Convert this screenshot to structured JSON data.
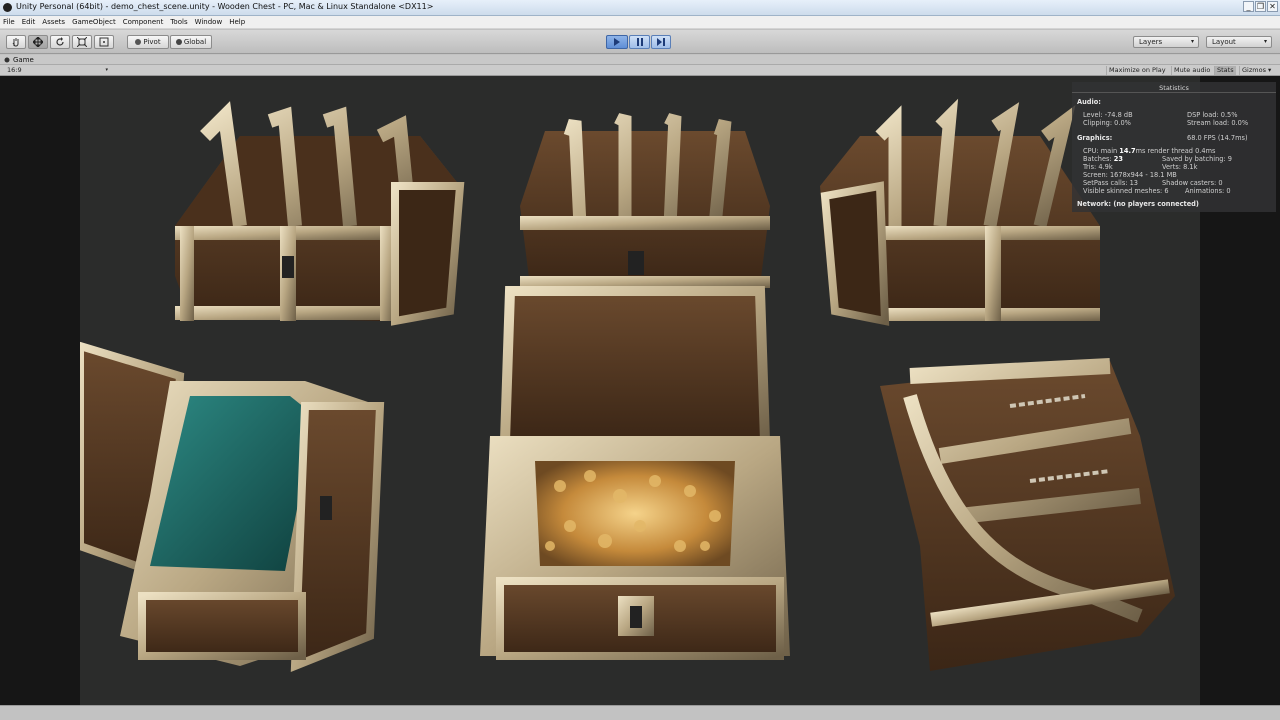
{
  "window": {
    "title": "Unity Personal (64bit) - demo_chest_scene.unity - Wooden Chest - PC, Mac & Linux Standalone <DX11>",
    "minimize": "_",
    "restore": "❐",
    "close": "✕"
  },
  "menu": [
    "File",
    "Edit",
    "Assets",
    "GameObject",
    "Component",
    "Tools",
    "Window",
    "Help"
  ],
  "toolbar": {
    "pivot_label": "Pivot",
    "global_label": "Global",
    "layers_label": "Layers",
    "layout_label": "Layout"
  },
  "game_view": {
    "tab_label": "Game",
    "aspect": "16:9",
    "maximize_on_play": "Maximize on Play",
    "mute_audio": "Mute audio",
    "stats": "Stats",
    "gizmos": "Gizmos"
  },
  "statistics": {
    "title": "Statistics",
    "audio_header": "Audio:",
    "level": "Level: -74.8 dB",
    "clipping": "Clipping: 0.0%",
    "dsp_load": "DSP load: 0.5%",
    "stream_load": "Stream load: 0.0%",
    "graphics_header": "Graphics:",
    "fps": "68.0 FPS (14.7ms)",
    "cpu_main_prefix": "CPU: main ",
    "cpu_main_value": "14.7",
    "cpu_main_suffix": "ms  render thread 0.4ms",
    "batches_prefix": "Batches: ",
    "batches_value": "23",
    "saved_by_batching": "Saved by batching: 9",
    "tris": "Tris: 4.9k",
    "verts": "Verts: 8.1k",
    "screen": "Screen: 1678x944 - 18.1 MB",
    "setpass": "SetPass calls: 13",
    "shadow_casters": "Shadow casters: 0",
    "skinned": "Visible skinned meshes: 6",
    "animations": "Animations: 0",
    "network": "Network: (no players connected)"
  },
  "colors": {
    "wood": "#5a3a22",
    "metal": "#b9a98a",
    "interior": "#1f6b66",
    "gold": "#d39a3e",
    "background": "#2b2c2b"
  }
}
